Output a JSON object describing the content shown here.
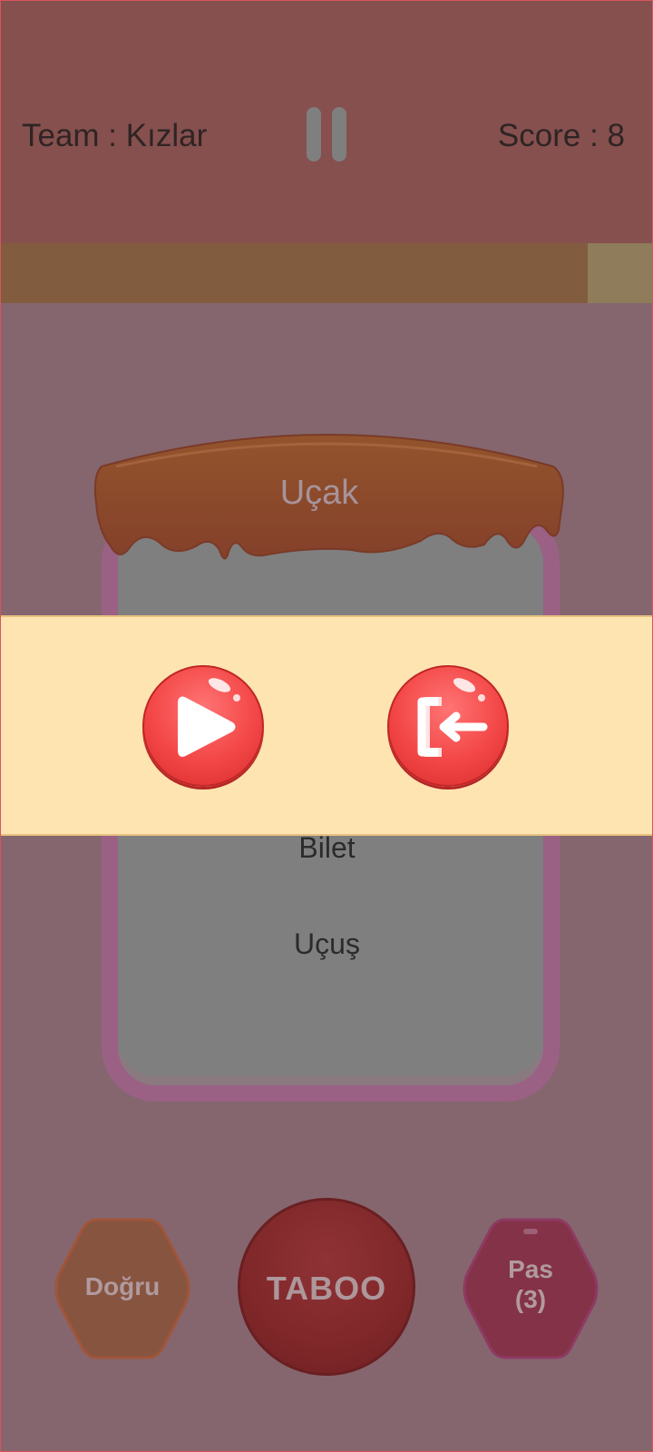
{
  "header": {
    "team_label": "Team : Kızlar",
    "score_label": "Score : 8"
  },
  "timer": {
    "remaining_fraction": 0.9
  },
  "card": {
    "title": "Uçak",
    "taboo_words": [
      "Bilet",
      "Uçuş"
    ]
  },
  "pause_menu": {
    "resume_icon": "play-icon",
    "exit_icon": "exit-icon"
  },
  "buttons": {
    "correct_label": "Doğru",
    "taboo_label": "TABOO",
    "pass_label": "Pas",
    "pass_count": "(3)"
  },
  "colors": {
    "header_bg": "#86504f",
    "overlay_bg": "#fde4b0",
    "button_red": "#f34646",
    "timer_fill": "#825c3e"
  }
}
